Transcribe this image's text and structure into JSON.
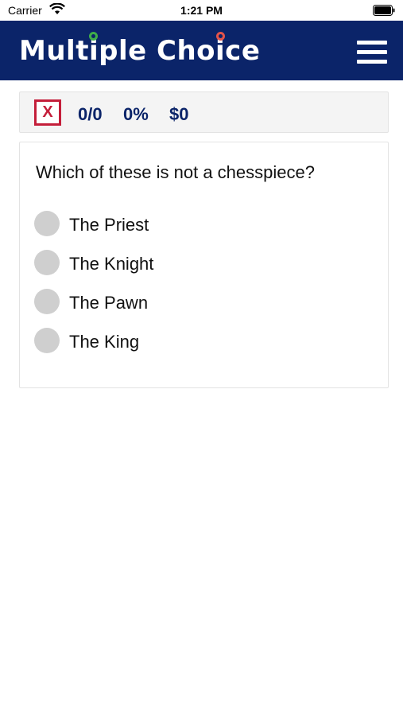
{
  "status_bar": {
    "carrier": "Carrier",
    "time": "1:21 PM"
  },
  "header": {
    "title": "Multiple Choice",
    "menu_icon": "hamburger-menu-icon",
    "background_color": "#0b2469"
  },
  "score": {
    "close_label": "X",
    "count": "0/0",
    "percent": "0%",
    "money": "$0"
  },
  "question": {
    "text": "Which of these is not a chesspiece?",
    "options": [
      {
        "label": "The Priest"
      },
      {
        "label": "The Knight"
      },
      {
        "label": "The Pawn"
      },
      {
        "label": "The King"
      }
    ]
  },
  "colors": {
    "accent_red": "#c41e3a",
    "navy": "#0b2469",
    "radio_gray": "#cfcfcf"
  }
}
